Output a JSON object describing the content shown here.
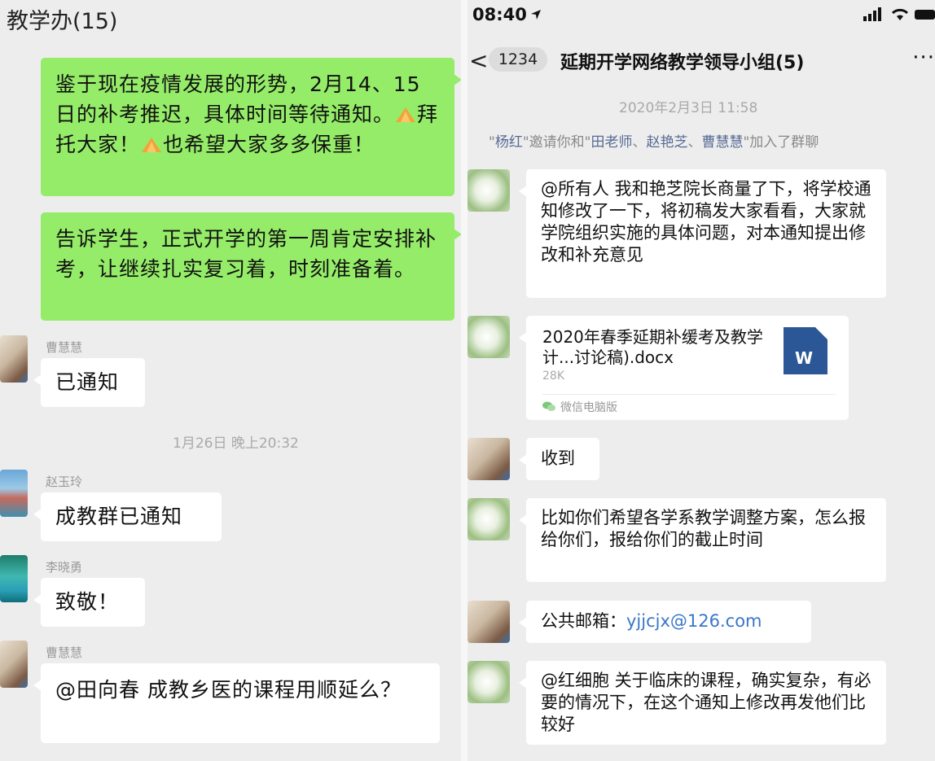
{
  "left": {
    "title": "教学办(15)",
    "msg1_a": "鉴于现在疫情发展的形势，2月14、15日的补考推迟，具体时间等待通知。",
    "msg1_b": "拜托大家！",
    "msg1_c": "也希望大家多多保重！",
    "msg2": "告诉学生，正式开学的第一周肯定安排补考，让继续扎实复习着，时刻准备着。",
    "sender1": "曹慧慧",
    "reply1": "已通知",
    "timestamp": "1月26日 晚上20:32",
    "sender2": "赵玉玲",
    "reply2": "成教群已通知",
    "sender3": "李晓勇",
    "reply3": "致敬！",
    "sender4": "曹慧慧",
    "reply4": "@田向春  成教乡医的课程用顺延么？"
  },
  "right": {
    "status_time": "08:40",
    "back_count": "1234",
    "group_title": "延期开学网络教学领导小组(5)",
    "more": "···",
    "date": "2020年2月3日 11:58",
    "invite": {
      "q1": "\"",
      "inviter": "杨红",
      "mid": "\"邀请你和\"",
      "n1": "田老师",
      "sep1": "、",
      "n2": "赵艳芝",
      "sep2": "、",
      "n3": "曹慧慧",
      "end": "\"加入了群聊"
    },
    "msg1": "@所有人 我和艳芝院长商量了下，将学校通知修改了一下，将初稿发大家看看，大家就学院组织实施的具体问题，对本通知提出修改和补充意见",
    "file": {
      "name": "2020年春季延期补缓考及教学计...讨论稿).docx",
      "size": "28K",
      "source": "微信电脑版",
      "icon_letter": "W"
    },
    "msg2": "收到",
    "msg3": "比如你们希望各学系教学调整方案，怎么报给你们，报给你们的截止时间",
    "msg4_label": "公共邮箱：",
    "msg4_email": "yjjcjx@126.com",
    "msg5": "@红细胞 关于临床的课程，确实复杂，有必要的情况下，在这个通知上修改再发他们比较好"
  },
  "colors": {
    "green_bubble": "#95ec69",
    "background": "#ededed",
    "link": "#3a77c7",
    "name_highlight": "#576b95",
    "word_icon": "#2b5797"
  }
}
